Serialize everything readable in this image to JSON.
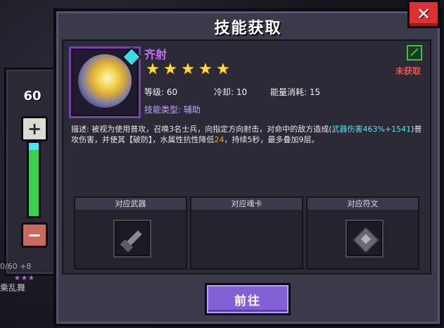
{
  "side": {
    "level": "60",
    "plus": "+",
    "minus": "−",
    "hp_text": "0/60 +8",
    "skill_text": "乘乱舞",
    "stars": "★★★"
  },
  "dialog": {
    "title": "技能获取",
    "close": "✕"
  },
  "skill": {
    "name": "齐射",
    "stars": 5,
    "level_label": "等级: 60",
    "cooldown_label": "冷却: 10",
    "energy_label": "能量消耗: 15",
    "type_label": "技能类型: 辅助",
    "status": "未获取",
    "desc_part1": "描述: 被视为使用普攻，召唤3名士兵，向指定方向射击，对命中的敌方造成(",
    "desc_highlight1": "武器伤害463%+1541",
    "desc_part2": ")普攻伤害，并使其【破防】，水属性抗性降低",
    "desc_highlight2": "24",
    "desc_part3": "，持续5秒，最多叠加9层。"
  },
  "slots": {
    "weapon": "对应武器",
    "card": "对应魂卡",
    "rune": "对应符文"
  },
  "go_button": "前往",
  "colors": {
    "accent_purple": "#8460d6",
    "name_color": "#c76af2",
    "status_red": "#e8554c",
    "highlight_cyan": "#4ee3f3",
    "highlight_orange": "#ff9a2b"
  }
}
